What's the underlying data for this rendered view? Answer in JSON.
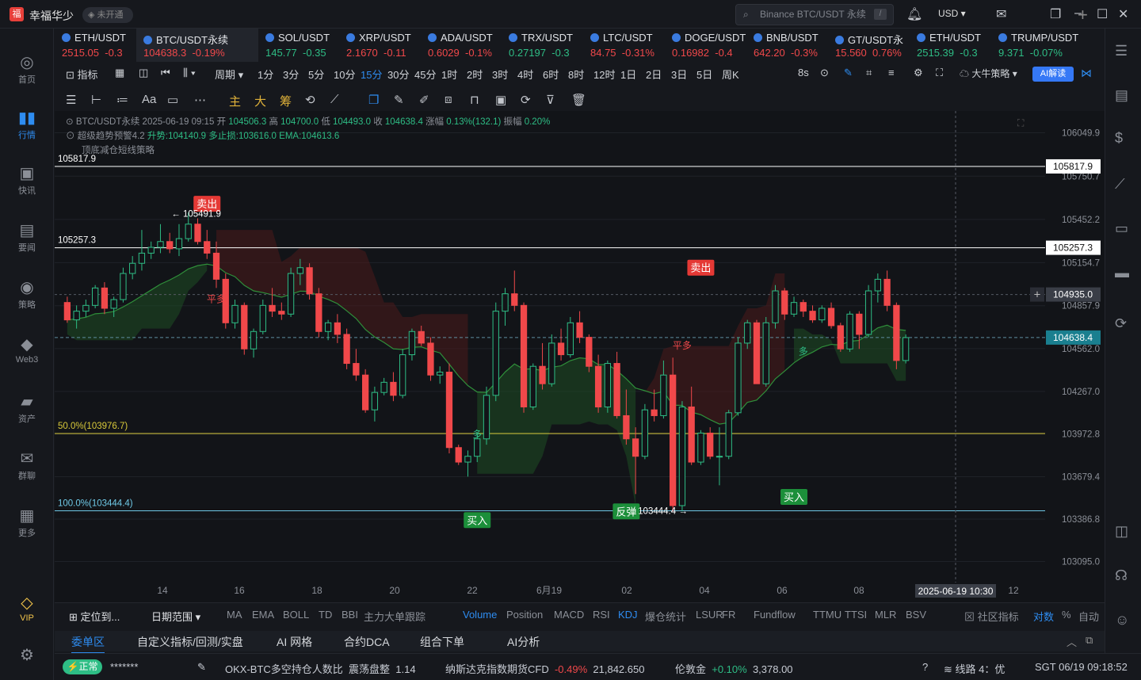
{
  "app": {
    "user_name": "幸福华少",
    "verify_badge": "未开通",
    "search_placeholder": "Binance BTC/USDT 永续",
    "currency": "USD"
  },
  "sidebar": [
    {
      "label": "首页",
      "icon": "home-icon"
    },
    {
      "label": "行情",
      "icon": "market-icon"
    },
    {
      "label": "快讯",
      "icon": "news-icon"
    },
    {
      "label": "要闻",
      "icon": "headlines-icon"
    },
    {
      "label": "策略",
      "icon": "strategy-icon"
    },
    {
      "label": "Web3",
      "icon": "web3-icon"
    },
    {
      "label": "资产",
      "icon": "wallet-icon"
    },
    {
      "label": "群聊",
      "icon": "chat-icon"
    },
    {
      "label": "更多",
      "icon": "more-icon"
    },
    {
      "label": "VIP",
      "icon": "vip-icon"
    }
  ],
  "tickers": [
    {
      "name": "ETH/USDT",
      "price": "2515.05",
      "change": "-0.3",
      "dir": "dn"
    },
    {
      "name": "BTC/USDT永续",
      "price": "104638.3",
      "change": "-0.19%",
      "dir": "dn"
    },
    {
      "name": "SOL/USDT",
      "price": "145.77",
      "change": "-0.35",
      "dir": "up"
    },
    {
      "name": "XRP/USDT",
      "price": "2.1670",
      "change": "-0.11",
      "dir": "dn"
    },
    {
      "name": "ADA/USDT",
      "price": "0.6029",
      "change": "-0.1%",
      "dir": "dn"
    },
    {
      "name": "TRX/USDT",
      "price": "0.27197",
      "change": "-0.3",
      "dir": "up"
    },
    {
      "name": "LTC/USDT",
      "price": "84.75",
      "change": "-0.31%",
      "dir": "dn"
    },
    {
      "name": "DOGE/USDT",
      "price": "0.16982",
      "change": "-0.4",
      "dir": "dn"
    },
    {
      "name": "BNB/USDT",
      "price": "642.20",
      "change": "-0.3%",
      "dir": "dn"
    },
    {
      "name": "GT/USDT永",
      "price": "15.560",
      "change": "0.76%",
      "dir": "dn"
    },
    {
      "name": "ETH/USDT",
      "price": "2515.39",
      "change": "-0.3",
      "dir": "up"
    },
    {
      "name": "TRUMP/USDT",
      "price": "9.371",
      "change": "-0.07%",
      "dir": "up"
    }
  ],
  "timeframes": {
    "indicator_label": "指标",
    "period_label": "周期",
    "items": [
      "1分",
      "3分",
      "5分",
      "10分",
      "15分",
      "30分",
      "45分",
      "1时",
      "2时",
      "3时",
      "4时",
      "6时",
      "8时",
      "12时",
      "1日",
      "2日",
      "3日",
      "5日",
      "周K"
    ],
    "selected": "15分",
    "refresh": "8s",
    "strategy": "大牛策略",
    "ai_button": "AI解读"
  },
  "draw_tools": {
    "main": "主",
    "big": "大",
    "chip": "筹"
  },
  "chart_info": {
    "line1": {
      "symbol": "BTC/USDT永续",
      "time": "2025-06-19 09:15",
      "open_label": "开",
      "open": "104506.3",
      "high_label": "高",
      "high": "104700.0",
      "low_label": "低",
      "low": "104493.0",
      "close_label": "收",
      "close": "104638.4",
      "chg_label": "涨幅",
      "chg": "0.13%(132.1)",
      "amp_label": "振幅",
      "amp": "0.20%"
    },
    "line2": {
      "name": "超级趋势预警4.2",
      "trend": "升势:104140.9",
      "stop": "多止损:103616.0",
      "ema": "EMA:104613.6"
    },
    "line3": "顶底减仓短线策略"
  },
  "chart_data": {
    "type": "candlestick",
    "symbol": "BTC/USDT永续",
    "interval": "15分",
    "ylim": [
      102950,
      106200
    ],
    "y_ticks": [
      106049.9,
      105750.7,
      105452.2,
      105154.7,
      104857.9,
      104562.0,
      104267.0,
      103972.8,
      103679.4,
      103386.8,
      103095.0
    ],
    "x_ticks": [
      "14",
      "16",
      "18",
      "20",
      "22",
      "6月19",
      "02",
      "04",
      "06",
      "08",
      "12"
    ],
    "candles": [
      [
        104880,
        104920,
        104740,
        104760
      ],
      [
        104760,
        104860,
        104700,
        104820
      ],
      [
        104820,
        104900,
        104780,
        104860
      ],
      [
        104860,
        105000,
        104840,
        104980
      ],
      [
        104980,
        105020,
        104800,
        104840
      ],
      [
        104840,
        104920,
        104780,
        104900
      ],
      [
        104900,
        105120,
        104880,
        105080
      ],
      [
        105080,
        105200,
        105040,
        105150
      ],
      [
        105150,
        105380,
        105100,
        105220
      ],
      [
        105220,
        105300,
        105180,
        105260
      ],
      [
        105260,
        105420,
        105220,
        105300
      ],
      [
        105300,
        105360,
        105220,
        105250
      ],
      [
        105250,
        105420,
        105200,
        105320
      ],
      [
        105320,
        105500,
        105300,
        105420
      ],
      [
        105420,
        105460,
        105280,
        105300
      ],
      [
        105300,
        105380,
        105180,
        105220
      ],
      [
        105220,
        105300,
        104980,
        105040
      ],
      [
        105040,
        105080,
        104700,
        104740
      ],
      [
        104740,
        104900,
        104700,
        104860
      ],
      [
        104860,
        104880,
        104520,
        104560
      ],
      [
        104560,
        104700,
        104500,
        104680
      ],
      [
        104680,
        104900,
        104660,
        104860
      ],
      [
        104860,
        104980,
        104780,
        104820
      ],
      [
        104820,
        104880,
        104760,
        104800
      ],
      [
        104800,
        105120,
        104780,
        105080
      ],
      [
        105080,
        105180,
        105000,
        105120
      ],
      [
        105120,
        105150,
        104900,
        104940
      ],
      [
        104940,
        104980,
        104640,
        104680
      ],
      [
        104680,
        104760,
        104620,
        104740
      ],
      [
        104740,
        104800,
        104600,
        104660
      ],
      [
        104660,
        104700,
        104420,
        104460
      ],
      [
        104460,
        104560,
        104340,
        104380
      ],
      [
        104380,
        104420,
        104120,
        104140
      ],
      [
        104140,
        104300,
        104060,
        104260
      ],
      [
        104260,
        104360,
        104240,
        104330
      ],
      [
        104330,
        104400,
        104200,
        104240
      ],
      [
        104240,
        104560,
        104220,
        104520
      ],
      [
        104520,
        104700,
        104480,
        104680
      ],
      [
        104680,
        104720,
        104580,
        104600
      ],
      [
        104600,
        104640,
        104340,
        104380
      ],
      [
        104380,
        104440,
        104320,
        104400
      ],
      [
        104400,
        104460,
        103840,
        103880
      ],
      [
        103880,
        103900,
        103760,
        103780
      ],
      [
        103780,
        103860,
        103680,
        103820
      ],
      [
        103820,
        103980,
        103780,
        103940
      ],
      [
        103940,
        104300,
        103900,
        104240
      ],
      [
        104240,
        104880,
        104200,
        104820
      ],
      [
        104820,
        104980,
        104720,
        104940
      ],
      [
        104940,
        105100,
        104820,
        104860
      ],
      [
        104860,
        104880,
        104120,
        104160
      ],
      [
        104160,
        104460,
        104140,
        104440
      ],
      [
        104440,
        104600,
        104280,
        104320
      ],
      [
        104320,
        104660,
        104300,
        104600
      ],
      [
        104600,
        104700,
        104480,
        104520
      ],
      [
        104520,
        104780,
        104500,
        104740
      ],
      [
        104740,
        104820,
        104600,
        104640
      ],
      [
        104640,
        104660,
        104400,
        104440
      ],
      [
        104440,
        104520,
        104120,
        104160
      ],
      [
        104160,
        104480,
        104120,
        104460
      ],
      [
        104460,
        104540,
        104080,
        104100
      ],
      [
        104100,
        104280,
        103900,
        103940
      ],
      [
        103940,
        104020,
        103560,
        103820
      ],
      [
        103820,
        104180,
        103800,
        104140
      ],
      [
        104140,
        104280,
        104060,
        104100
      ],
      [
        104100,
        104480,
        104080,
        104380
      ],
      [
        104380,
        104500,
        103440,
        103480
      ],
      [
        103480,
        104200,
        103440,
        104160
      ],
      [
        104160,
        104300,
        103760,
        103780
      ],
      [
        103780,
        104000,
        103760,
        103980
      ],
      [
        103980,
        104020,
        103800,
        103820
      ],
      [
        103820,
        104020,
        103620,
        103820
      ],
      [
        103820,
        104140,
        103800,
        104120
      ],
      [
        104120,
        104640,
        104100,
        104600
      ],
      [
        104600,
        104760,
        104560,
        104740
      ],
      [
        104740,
        104760,
        104320,
        104320
      ],
      [
        104320,
        104780,
        104300,
        104740
      ],
      [
        104740,
        105000,
        104700,
        104960
      ],
      [
        104960,
        104980,
        104760,
        104800
      ],
      [
        104800,
        104920,
        104780,
        104880
      ],
      [
        104880,
        104900,
        104780,
        104820
      ],
      [
        104820,
        104860,
        104740,
        104760
      ],
      [
        104760,
        104860,
        104740,
        104840
      ],
      [
        104840,
        104880,
        104700,
        104720
      ],
      [
        104720,
        104740,
        104540,
        104560
      ],
      [
        104560,
        104820,
        104540,
        104800
      ],
      [
        104800,
        104820,
        104560,
        104660
      ],
      [
        104660,
        105000,
        104640,
        104960
      ],
      [
        104960,
        105080,
        104880,
        105040
      ],
      [
        105040,
        105100,
        104820,
        104860
      ],
      [
        104860,
        104880,
        104420,
        104480
      ],
      [
        104480,
        104660,
        104460,
        104638
      ]
    ],
    "levels": [
      {
        "label": "105817.9",
        "value": 105817.9,
        "color": "#ffffff"
      },
      {
        "label": "105257.3",
        "value": 105257.3,
        "color": "#ffffff"
      },
      {
        "label": "50.0%(103976.7)",
        "value": 103976.7,
        "color": "#d8c93a"
      },
      {
        "label": "100.0%(103444.4)",
        "value": 103444.4,
        "color": "#6fc9e6"
      }
    ],
    "current_price": "104638.4",
    "crosshair_price": "104935.0",
    "crosshair_time": "2025-06-19 10:30",
    "annotations": [
      {
        "text": "卖出",
        "type": "sell",
        "candle": 15,
        "value": 105560
      },
      {
        "text": "卖出",
        "type": "sell",
        "candle": 68,
        "value": 105120
      },
      {
        "text": "买入",
        "type": "buy",
        "candle": 44,
        "value": 103380
      },
      {
        "text": "反弹",
        "type": "buy",
        "candle": 60,
        "value": 103440
      },
      {
        "text": "买入",
        "type": "buy",
        "candle": 78,
        "value": 103540
      },
      {
        "text": "平多",
        "type": "close",
        "candle": 16,
        "value": 104880
      },
      {
        "text": "平多",
        "type": "close",
        "candle": 66,
        "value": 104560
      },
      {
        "text": "多",
        "type": "long",
        "candle": 44,
        "value": 103950
      },
      {
        "text": "多",
        "type": "long",
        "candle": 79,
        "value": 104520
      }
    ],
    "high_marker": "105491.9",
    "low_marker": "103444.4"
  },
  "indicator_bar": {
    "locate": "定位到...",
    "range": "日期范围",
    "items": [
      "MA",
      "EMA",
      "BOLL",
      "TD",
      "BBI",
      "主力大单跟踪",
      "Volume",
      "Position",
      "MACD",
      "RSI",
      "KDJ",
      "爆仓统计",
      "LSUR",
      "FR",
      "Fundflow",
      "TTMU",
      "TTSI",
      "MLR",
      "BSV"
    ],
    "selected": [
      "Volume",
      "KDJ"
    ],
    "community": "社区指标",
    "log": "对数",
    "pct": "%",
    "auto": "自动"
  },
  "panel_tabs": [
    "委单区",
    "自定义指标/回测/实盘",
    "AI 网格",
    "合约DCA",
    "组合下单",
    "AI分析"
  ],
  "status": {
    "normal": "正常",
    "account": "*******",
    "ticker1_name": "OKX-BTC多空持仓人数比",
    "ticker1_state": "震荡盘整",
    "ticker1_val": "1.14",
    "ticker2_name": "纳斯达克指数期货CFD",
    "ticker2_chg": "-0.49%",
    "ticker2_val": "21,842.650",
    "ticker3_name": "伦敦金",
    "ticker3_chg": "+0.10%",
    "ticker3_val": "3,378.00",
    "line": "线路 4：优",
    "clock": "SGT 06/19 09:18:52"
  },
  "colors": {
    "up": "#2ebd85",
    "down": "#f0484a",
    "accent": "#2e8cf0"
  }
}
